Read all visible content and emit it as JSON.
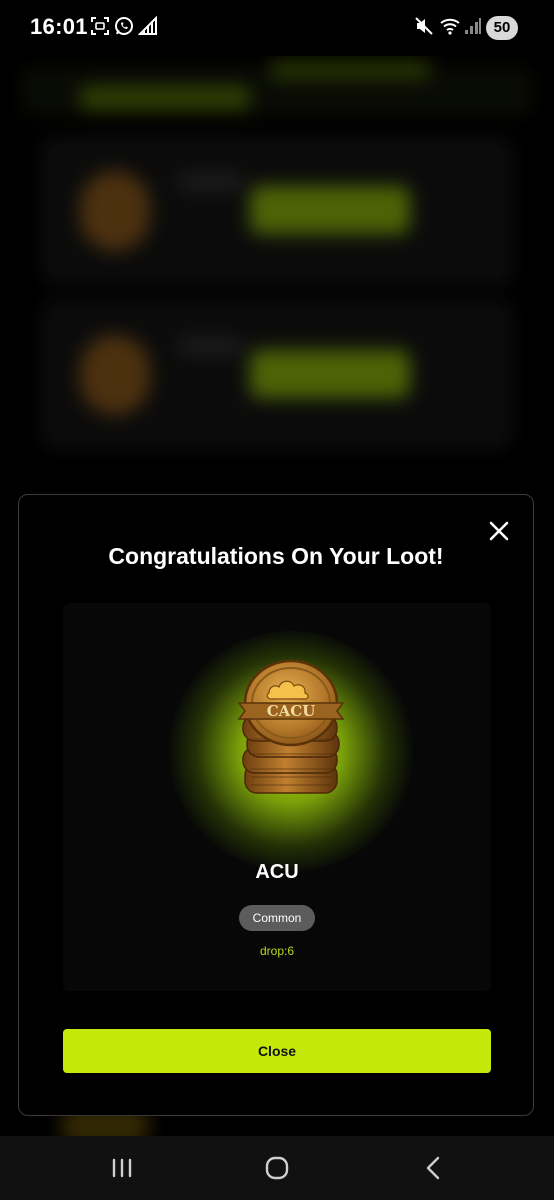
{
  "status_bar": {
    "time": "16:01",
    "battery": "50",
    "icons": [
      "screenshot-icon",
      "whatsapp-icon",
      "signal-boost-icon",
      "mute-icon",
      "wifi-icon",
      "signal-icon"
    ]
  },
  "modal": {
    "title": "Congratulations On Your Loot!",
    "close_icon": "close-icon",
    "item": {
      "name": "ACU",
      "image_label": "CACU",
      "rarity": "Common",
      "drop": "drop:6"
    },
    "close_button_label": "Close"
  },
  "nav_bar": {
    "icons": [
      "recent-apps-icon",
      "home-icon",
      "back-icon"
    ]
  },
  "colors": {
    "accent": "#c5e80b",
    "drop_text": "#b6dc1a",
    "badge_bg": "#5c5c5c",
    "modal_bg": "#000000"
  }
}
